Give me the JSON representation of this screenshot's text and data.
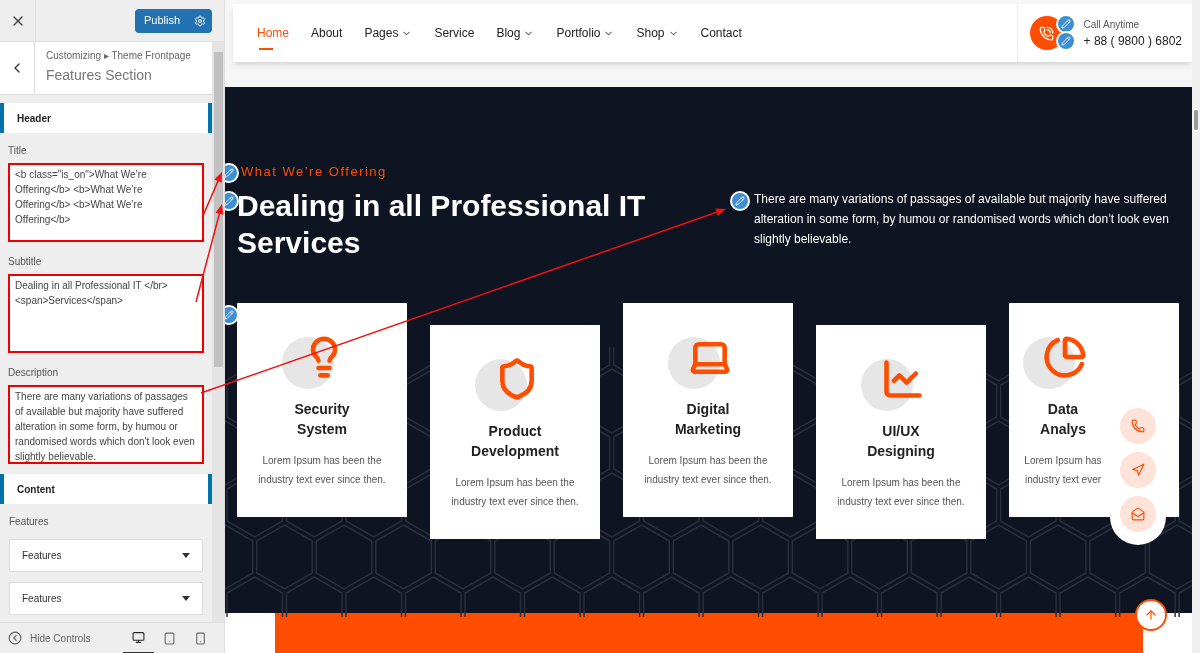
{
  "customizer": {
    "publish_label": "Publish",
    "breadcrumb": [
      "Customizing",
      "Theme Frontpage"
    ],
    "breadcrumb_separator": "▸",
    "section_title": "Features Section",
    "groups": [
      {
        "heading": "Header",
        "fields": [
          {
            "label": "Title",
            "value": "<b class=\"is_on\">What We’re Offering</b> <b>What We’re Offering</b> <b>What We’re Offering</b>",
            "highlighted": true
          },
          {
            "label": "Subtitle",
            "value": "Dealing in all Professional IT </br>\n<span>Services</span>",
            "highlighted": true
          },
          {
            "label": "Description",
            "value": "There are many variations of passages of available but majority have suffered alteration in some form, by humou or randomised words which don't look even slightly believable.",
            "highlighted": true
          }
        ]
      },
      {
        "heading": "Content",
        "repeater_label": "Features",
        "items": [
          "Features",
          "Features"
        ]
      }
    ],
    "hide_controls": "Hide Controls",
    "devices": [
      {
        "kind": "desktop",
        "selected": true
      },
      {
        "kind": "tablet",
        "selected": false
      },
      {
        "kind": "mobile",
        "selected": false
      }
    ]
  },
  "site": {
    "nav": [
      {
        "label": "Home",
        "selected": true,
        "dropdown": false
      },
      {
        "label": "About",
        "selected": false,
        "dropdown": false
      },
      {
        "label": "Pages",
        "selected": false,
        "dropdown": true
      },
      {
        "label": "Service",
        "selected": false,
        "dropdown": false
      },
      {
        "label": "Blog",
        "selected": false,
        "dropdown": true
      },
      {
        "label": "Portfolio",
        "selected": false,
        "dropdown": true
      },
      {
        "label": "Shop",
        "selected": false,
        "dropdown": true
      },
      {
        "label": "Contact",
        "selected": false,
        "dropdown": false
      }
    ],
    "call_label": "Call Anytime",
    "phone": "+ 88 ( 9800 ) 6802",
    "tagline": "What We’re Offering",
    "heading": [
      "Dealing in all Professional IT",
      "Services"
    ],
    "description": "There are many variations of passages of available but majority have suffered alteration in some form, by humou or randomised words which don’t look even slightly believable.",
    "cards": [
      {
        "kind": "bulb",
        "title": [
          "Security",
          "System"
        ],
        "text": [
          "Lorem Ipsum has been the",
          "industry text ever since then."
        ]
      },
      {
        "kind": "shield",
        "title": [
          "Product",
          "Development"
        ],
        "text": [
          "Lorem Ipsum has been the",
          "industry text ever since then."
        ]
      },
      {
        "kind": "laptop",
        "title": [
          "Digital",
          "Marketing"
        ],
        "text": [
          "Lorem Ipsum has been the",
          "industry text ever since then."
        ]
      },
      {
        "kind": "chart",
        "title": [
          "UI/UX",
          "Designing"
        ],
        "text": [
          "Lorem Ipsum has been the",
          "industry text ever since then."
        ]
      },
      {
        "kind": "pie",
        "title": [
          "Data",
          "Analys"
        ],
        "text": [
          "Lorem Ipsum has",
          "industry text ever"
        ]
      }
    ]
  }
}
